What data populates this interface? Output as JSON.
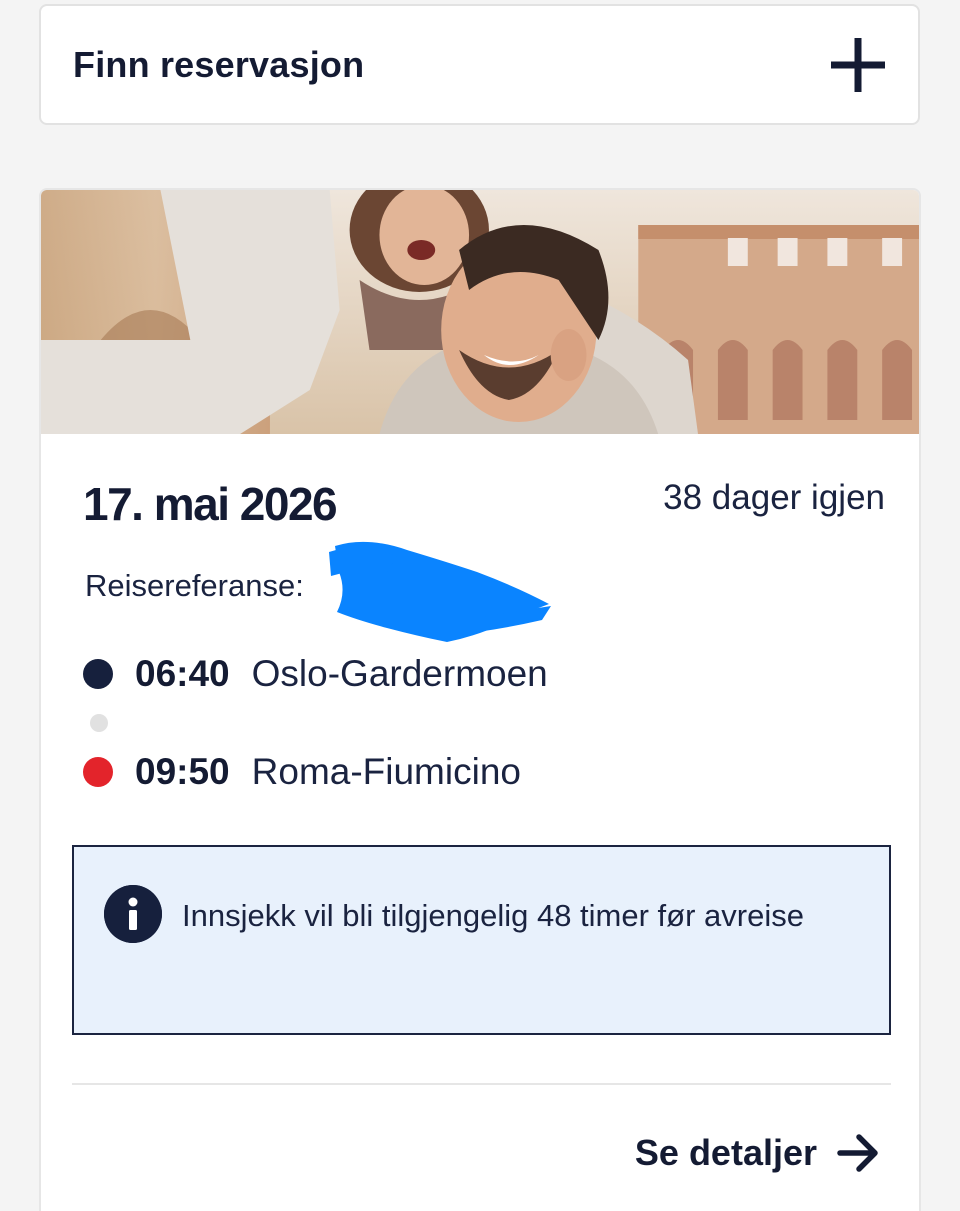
{
  "find_reservation": {
    "title": "Finn reservasjon",
    "icon": "plus-icon"
  },
  "trip": {
    "date": "17. mai 2026",
    "days_left": "38 dager igjen",
    "reference_label": "Reisereferanse:",
    "departure": {
      "time": "06:40",
      "airport": "Oslo-Gardermoen",
      "dot_color": "#16203d"
    },
    "arrival": {
      "time": "09:50",
      "airport": "Roma-Fiumicino",
      "dot_color": "#e3242b"
    },
    "info": {
      "icon": "info-icon",
      "text": "Innsjekk vil bli tilgjengelig 48 timer før avreise"
    },
    "details_link": {
      "label": "Se detaljer",
      "icon": "arrow-right-icon"
    }
  },
  "colors": {
    "navy": "#141b33",
    "info_background": "#e8f1fc",
    "arrival_red": "#e3242b",
    "redaction_blue": "#0a84ff"
  }
}
